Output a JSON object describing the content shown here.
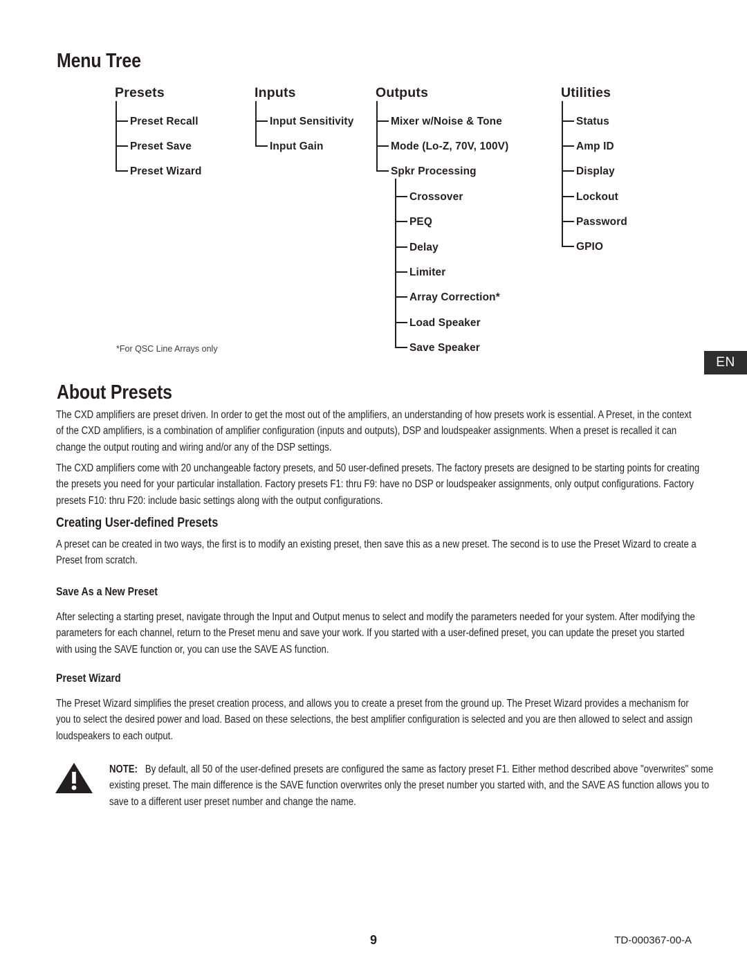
{
  "document": {
    "section_title": "Menu Tree",
    "language_tab": "EN",
    "footnote": "*For QSC Line Arrays only",
    "footer": {
      "page_number": "9",
      "doc_id": "TD-000367-00-A"
    }
  },
  "menu_tree": {
    "columns": [
      {
        "header": "Presets",
        "items": [
          "Preset Recall",
          "Preset Save",
          "Preset Wizard"
        ]
      },
      {
        "header": "Inputs",
        "items": [
          "Input Sensitivity",
          "Input Gain"
        ]
      },
      {
        "header": "Outputs",
        "items": [
          "Mixer w/Noise & Tone",
          "Mode (Lo-Z, 70V, 100V)",
          "Spkr Processing"
        ],
        "subitems": [
          "Crossover",
          "PEQ",
          "Delay",
          "Limiter",
          "Array Correction*",
          "Load Speaker",
          "Save Speaker"
        ]
      },
      {
        "header": "Utilities",
        "items": [
          "Status",
          "Amp ID",
          "Display",
          "Lockout",
          "Password",
          "GPIO"
        ]
      }
    ]
  },
  "about_presets": {
    "heading": "About Presets",
    "paragraph_1": "The CXD amplifiers are preset driven. In order to get the most out of the amplifiers, an understanding of how presets work is essential. A Preset, in the context of the CXD amplifiers, is a combination of amplifier configuration (inputs and outputs), DSP and loudspeaker assignments. When a preset is recalled it can change the output routing and wiring and/or any of the DSP settings.",
    "paragraph_2": "The CXD amplifiers come with 20 unchangeable factory presets, and 50 user-defined presets. The factory presets are designed to be starting points for creating the presets you need for your particular installation. Factory presets F1: thru F9: have no DSP or loudspeaker assignments, only output configurations. Factory presets F10: thru F20: include basic settings along with the output configurations."
  },
  "creating_presets": {
    "heading": "Creating User-defined Presets",
    "paragraph": "A preset can be created in two ways, the first is to modify an existing preset, then save this as a new preset. The second is to use the Preset Wizard to create a Preset from scratch."
  },
  "save_as_new_preset": {
    "heading": "Save As a New Preset",
    "paragraph": "After selecting a starting preset, navigate through the Input and Output menus to select and modify the parameters needed for your system. After modifying the parameters for each channel, return to the Preset menu and save your work. If you started with a user-defined preset, you can update the preset you started with using the SAVE function or, you can use the SAVE AS function."
  },
  "preset_wizard": {
    "heading": "Preset Wizard",
    "paragraph": "The Preset Wizard simplifies the preset creation process, and allows you to create a preset from the ground up. The Preset Wizard provides a mechanism for you to select the desired power and load. Based on these selections, the best amplifier configuration is selected and you are then allowed to select and assign loudspeakers to each output."
  },
  "note": {
    "label": "NOTE:",
    "text": "By default, all 50 of the user-defined presets are configured the same as factory preset F1. Either method described above \"overwrites\" some existing preset. The main difference is the SAVE function overwrites only the preset number you started with, and the SAVE AS function allows you to save to a different user preset number and change the name."
  }
}
